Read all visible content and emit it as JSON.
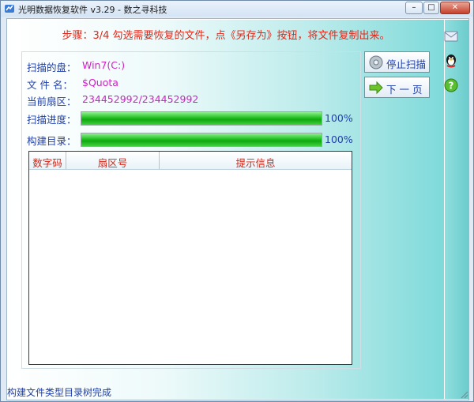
{
  "window": {
    "title": "光明数据恢复软件 v3.29 - 数之寻科技",
    "min_label": "–",
    "max_label": "□",
    "close_label": "✕"
  },
  "step_text": "步骤：3/4 勾选需要恢复的文件，点《另存为》按钮，将文件复制出来。",
  "info": {
    "disk_label": "扫描的盘：",
    "disk_value": "Win7(C:)",
    "filename_label": "文 件 名：",
    "filename_value": "$Quota",
    "sector_label": "当前扇区：",
    "sector_value": "234452992/234452992"
  },
  "progress": {
    "scan_label": "扫描进度：",
    "scan_percent": "100%",
    "scan_value": 1.0,
    "build_label": "构建目录：",
    "build_percent": "100%",
    "build_value": 1.0,
    "bar_color": "#1fbf1f"
  },
  "table": {
    "headers": [
      "数字码",
      "扇区号",
      "提示信息"
    ],
    "rows": []
  },
  "buttons": {
    "stop_scan": "停止扫描",
    "next_page": "下 一 页"
  },
  "side_icons": [
    "mail-icon",
    "qq-penguin-icon",
    "help-icon"
  ],
  "status_text": "构建文件类型目录树完成",
  "colors": {
    "step_text": "#e0281a",
    "label_blue": "#1f3fa8",
    "value_magenta": "#d020c8",
    "panel_teal": "#7fdada"
  }
}
